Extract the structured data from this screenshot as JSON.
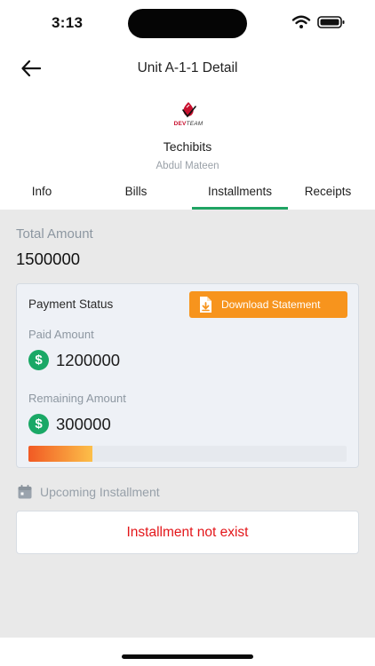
{
  "status_bar": {
    "time": "3:13"
  },
  "header": {
    "title": "Unit A-1-1 Detail",
    "logo": {
      "text_dev": "DEV",
      "text_team": "TEAM",
      "brand_color": "#c8102e"
    },
    "company": "Techibits",
    "person": "Abdul Mateen"
  },
  "tabs": [
    {
      "label": "Info",
      "active": false
    },
    {
      "label": "Bills",
      "active": false
    },
    {
      "label": "Installments",
      "active": true
    },
    {
      "label": "Receipts",
      "active": false
    }
  ],
  "total": {
    "label": "Total Amount",
    "value": "1500000"
  },
  "payment_card": {
    "title": "Payment Status",
    "download_label": "Download Statement",
    "paid_label": "Paid Amount",
    "paid_value": "1200000",
    "remaining_label": "Remaining Amount",
    "remaining_value": "300000",
    "progress_fraction": 0.2,
    "currency_icon": "dollar-coin-icon"
  },
  "upcoming": {
    "label": "Upcoming Installment",
    "empty_message": "Installment not exist"
  },
  "colors": {
    "accent_green": "#1fa463",
    "button_orange": "#f7941d",
    "error_red": "#e3161a"
  }
}
